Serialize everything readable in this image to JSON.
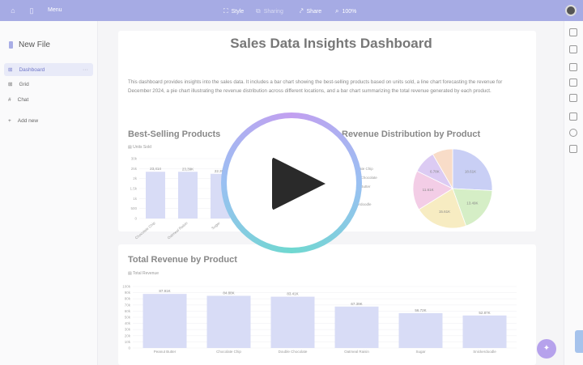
{
  "topbar": {
    "menu_label": "Menu",
    "style_label": "Style",
    "sharing_label": "Sharing",
    "share_label": "Share",
    "zoom_label": "100%"
  },
  "sidebar": {
    "new_file_label": "New File",
    "items": [
      {
        "label": "Dashboard",
        "icon": "dashboard-icon",
        "active": true
      },
      {
        "label": "Grid",
        "icon": "grid-icon",
        "active": false
      },
      {
        "label": "Chat",
        "icon": "hash-icon",
        "active": false
      }
    ],
    "add_new_label": "Add new"
  },
  "dashboard": {
    "title": "Sales Data Insights Dashboard",
    "description": "This dashboard provides insights into the sales data. It includes a bar chart showing the best-selling products based on units sold, a line chart forecasting the revenue for December 2024, a pie chart illustrating the revenue distribution across different locations, and a bar chart summarizing the total revenue generated by each product."
  },
  "colors": {
    "accent": "#a6abe4",
    "bar": "#d8dcf6",
    "pie": [
      "#c9cff5",
      "#d5eec6",
      "#f7ecc2",
      "#f3cde6",
      "#dccbf3",
      "#f8dcc8"
    ]
  },
  "chart_data": [
    {
      "type": "bar",
      "title": "Best-Selling Products",
      "legend": "Units Sold",
      "categories": [
        "Chocolate Chip",
        "Oatmeal Raisin",
        "Sugar"
      ],
      "values": [
        23414,
        23398,
        22398
      ],
      "data_labels": [
        "23,414",
        "23,39K",
        "22.39K"
      ],
      "ylim": [
        0,
        30000
      ],
      "y_ticks": [
        "30k",
        "25k",
        "2k",
        "1.5k",
        "1k",
        "500",
        "0"
      ]
    },
    {
      "type": "pie",
      "title": "Revenue Distribution by Product",
      "legend": [
        "Chocolate Chip",
        "Double Chocolate",
        "Peanut Butter",
        "Sugar",
        "Snickerdoodle"
      ],
      "labels": [
        "18.61K",
        "13.49K",
        "15.61K",
        "11.61K",
        "6.78K",
        ""
      ],
      "values": [
        18.61,
        13.49,
        15.61,
        11.61,
        6.78,
        6.0
      ]
    },
    {
      "type": "bar",
      "title": "Total Revenue by Product",
      "legend": "Total Revenue",
      "categories": [
        "Peanut Butter",
        "Chocolate Chip",
        "Double Chocolate",
        "Oatmeal Raisin",
        "Sugar",
        "Snickerdoodle"
      ],
      "values": [
        87910,
        84880,
        83410,
        67390,
        56720,
        52870
      ],
      "data_labels": [
        "87.91K",
        "84.88K",
        "83.41K",
        "67.39K",
        "56.72K",
        "52.87K"
      ],
      "ylim": [
        0,
        100000
      ],
      "y_ticks": [
        "100k",
        "90k",
        "80k",
        "70k",
        "60k",
        "50k",
        "40k",
        "30k",
        "20k",
        "10k",
        "0"
      ]
    }
  ]
}
